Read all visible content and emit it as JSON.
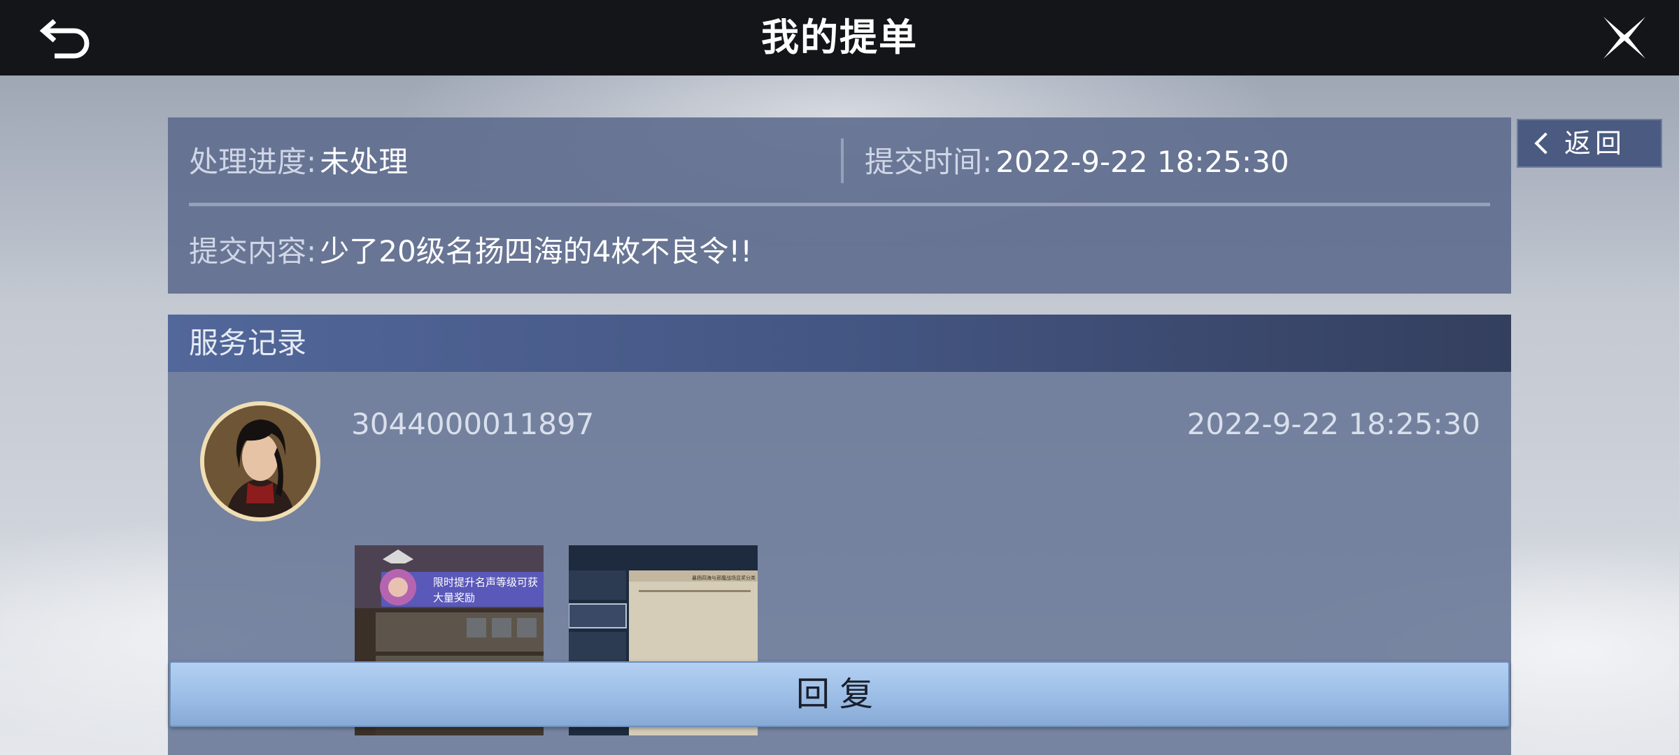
{
  "header": {
    "title": "我的提单"
  },
  "ticket": {
    "status_label": "处理进度:",
    "status_value": "未处理",
    "time_label": "提交时间:",
    "time_value": "2022-9-22 18:25:30",
    "content_label": "提交内容:",
    "content_value": "少了20级名扬四海的4枚不良令!!"
  },
  "return_button": {
    "label": "返回"
  },
  "service_record": {
    "title": "服务记录",
    "entries": [
      {
        "user_id": "3044000011897",
        "time": "2022-9-22 18:25:30",
        "attachments": [
          {
            "text_line1": "限时提升名声等级可获",
            "text_line2": "大量奖励"
          },
          {
            "text_line1": "暴扬四海与邪魔战场显奖分类"
          }
        ]
      }
    ]
  },
  "reply_button": {
    "label": "回复"
  },
  "colors": {
    "topbar": "#141519",
    "panel": "#5c6a8c",
    "reply_button": "#9bbde6",
    "avatar_border": "#f1dfb4"
  },
  "icons": {
    "back": "back-arrow-icon",
    "close": "close-x-icon",
    "chevron": "chevron-left-icon"
  }
}
